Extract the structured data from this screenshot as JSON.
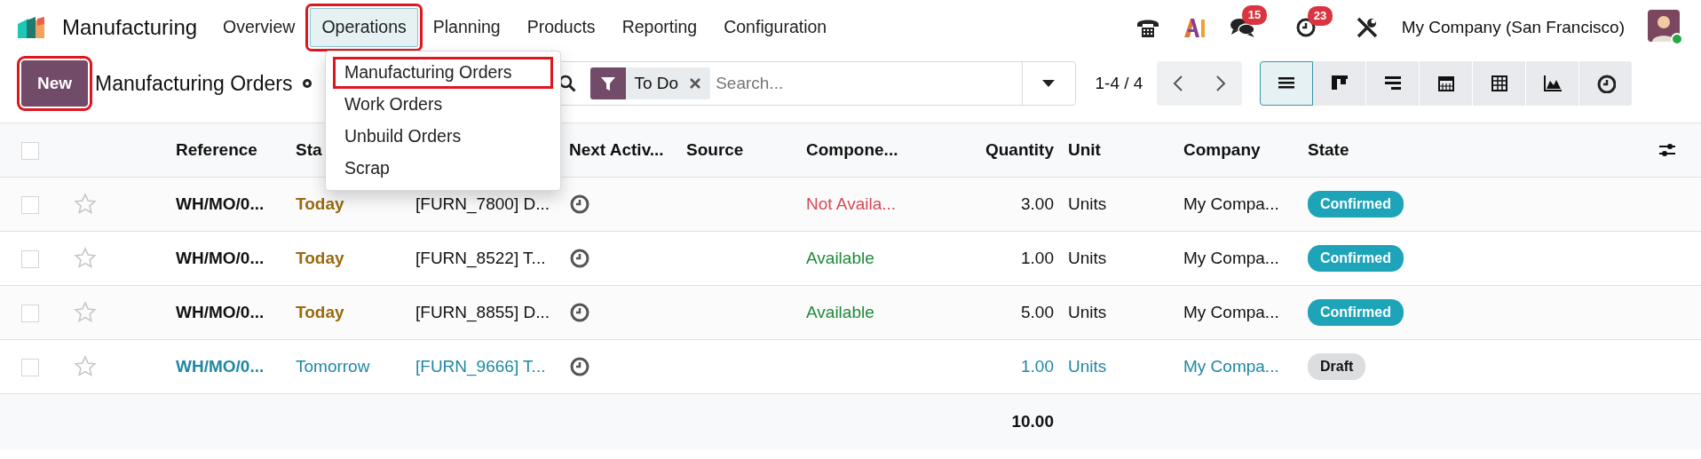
{
  "app": {
    "name": "Manufacturing"
  },
  "menu": [
    {
      "label": "Overview",
      "selected": false,
      "highlighted": false
    },
    {
      "label": "Operations",
      "selected": true,
      "highlighted": true
    },
    {
      "label": "Planning",
      "selected": false,
      "highlighted": false
    },
    {
      "label": "Products",
      "selected": false,
      "highlighted": false
    },
    {
      "label": "Reporting",
      "selected": false,
      "highlighted": false
    },
    {
      "label": "Configuration",
      "selected": false,
      "highlighted": false
    }
  ],
  "dropdown": [
    {
      "label": "Manufacturing Orders",
      "highlighted": true
    },
    {
      "label": "Work Orders",
      "highlighted": false
    },
    {
      "label": "Unbuild Orders",
      "highlighted": false
    },
    {
      "label": "Scrap",
      "highlighted": false
    }
  ],
  "systray": {
    "messages_count": "15",
    "activities_count": "23",
    "company": "My Company (San Francisco)"
  },
  "control": {
    "new_button": {
      "label": "New",
      "highlighted": true
    },
    "title": "Manufacturing Orders",
    "facet": "To Do",
    "search_placeholder": "Search...",
    "pager": "1-4 / 4"
  },
  "views": [
    {
      "kind": "list",
      "selected": true
    },
    {
      "kind": "kanban",
      "selected": false
    },
    {
      "kind": "gantt",
      "selected": false
    },
    {
      "kind": "calendar",
      "selected": false
    },
    {
      "kind": "pivot",
      "selected": false
    },
    {
      "kind": "graph",
      "selected": false
    },
    {
      "kind": "activity",
      "selected": false
    }
  ],
  "table": {
    "select_all": {
      "checked": false
    },
    "columns": [
      "Reference",
      "Sta",
      "Next Activ...",
      "Source",
      "Compone...",
      "Quantity",
      "Unit",
      "Company",
      "State"
    ],
    "rows": [
      {
        "checked": false,
        "reference": "WH/MO/0...",
        "start": {
          "text": "Today",
          "kind": "today"
        },
        "product": "[FURN_7800] D...",
        "components": {
          "text": "Not Availa...",
          "kind": "unavailable"
        },
        "quantity": "3.00",
        "unit": "Units",
        "company": "My Compa...",
        "state": {
          "label": "Confirmed",
          "kind": "confirmed"
        }
      },
      {
        "checked": false,
        "reference": "WH/MO/0...",
        "start": {
          "text": "Today",
          "kind": "today"
        },
        "product": "[FURN_8522] T...",
        "components": {
          "text": "Available",
          "kind": "available"
        },
        "quantity": "1.00",
        "unit": "Units",
        "company": "My Compa...",
        "state": {
          "label": "Confirmed",
          "kind": "confirmed"
        }
      },
      {
        "checked": false,
        "reference": "WH/MO/0...",
        "start": {
          "text": "Today",
          "kind": "today"
        },
        "product": "[FURN_8855] D...",
        "components": {
          "text": "Available",
          "kind": "available"
        },
        "quantity": "5.00",
        "unit": "Units",
        "company": "My Compa...",
        "state": {
          "label": "Confirmed",
          "kind": "confirmed"
        }
      },
      {
        "checked": false,
        "reference": "WH/MO/0...",
        "start": {
          "text": "Tomorrow",
          "kind": "tomorrow"
        },
        "product": "[FURN_9666] T...",
        "quantity": "1.00",
        "unit": "Units",
        "company": "My Compa...",
        "state": {
          "label": "Draft",
          "kind": "draft"
        }
      }
    ],
    "total_quantity": "10.00"
  }
}
